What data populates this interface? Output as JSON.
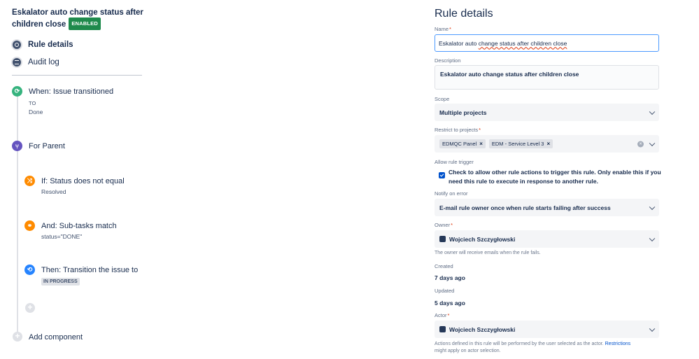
{
  "rule": {
    "title": "Eskalator auto change status after children close",
    "status_badge": "ENABLED"
  },
  "nav": {
    "rule_details": "Rule details",
    "audit_log": "Audit log"
  },
  "steps": {
    "when": {
      "title": "When: Issue transitioned",
      "sub_label": "TO",
      "sub_value": "Done"
    },
    "branch": {
      "title": "For Parent"
    },
    "condition1": {
      "title": "If: Status does not equal",
      "sub": "Resolved"
    },
    "condition2": {
      "title": "And: Sub-tasks match",
      "sub": "status=\"DONE\""
    },
    "action": {
      "title": "Then: Transition the issue to",
      "lozenge": "IN PROGRESS"
    },
    "add_component": "Add component"
  },
  "details": {
    "heading": "Rule details",
    "name_label": "Name",
    "name_value_prefix": "Eskalator auto ",
    "name_value_misspelled": "change status after children close",
    "description_label": "Description",
    "description_value": "Eskalator auto change status after children close",
    "scope_label": "Scope",
    "scope_value": "Multiple projects",
    "restrict_label": "Restrict to projects",
    "projects": [
      "EDMQC Panel",
      "EDM - Service Level 3"
    ],
    "allow_trigger_label": "Allow rule trigger",
    "allow_trigger_text": "Check to allow other rule actions to trigger this rule. Only enable this if you need this rule to execute in response to another rule.",
    "notify_label": "Notify on error",
    "notify_value": "E-mail rule owner once when rule starts failing after success",
    "owner_label": "Owner",
    "owner_value": "Wojciech Szczygłowski",
    "owner_helper": "The owner will receive emails when the rule fails.",
    "created_label": "Created",
    "created_value": "7 days ago",
    "updated_label": "Updated",
    "updated_value": "5 days ago",
    "actor_label": "Actor",
    "actor_value": "Wojciech Szczygłowski",
    "actor_helper_prefix": "Actions defined in this rule will be performed by the user selected as the actor. ",
    "actor_helper_link": "Restrictions",
    "actor_helper_suffix": "might apply on actor selection."
  },
  "colors": {
    "badge_green": "#1f8a4c",
    "trigger_green": "#36b37e",
    "branch_purple": "#6554c0",
    "condition_orange": "#ff8b00",
    "action_blue": "#2684ff",
    "link_blue": "#0052cc",
    "required_red": "#de350b"
  }
}
